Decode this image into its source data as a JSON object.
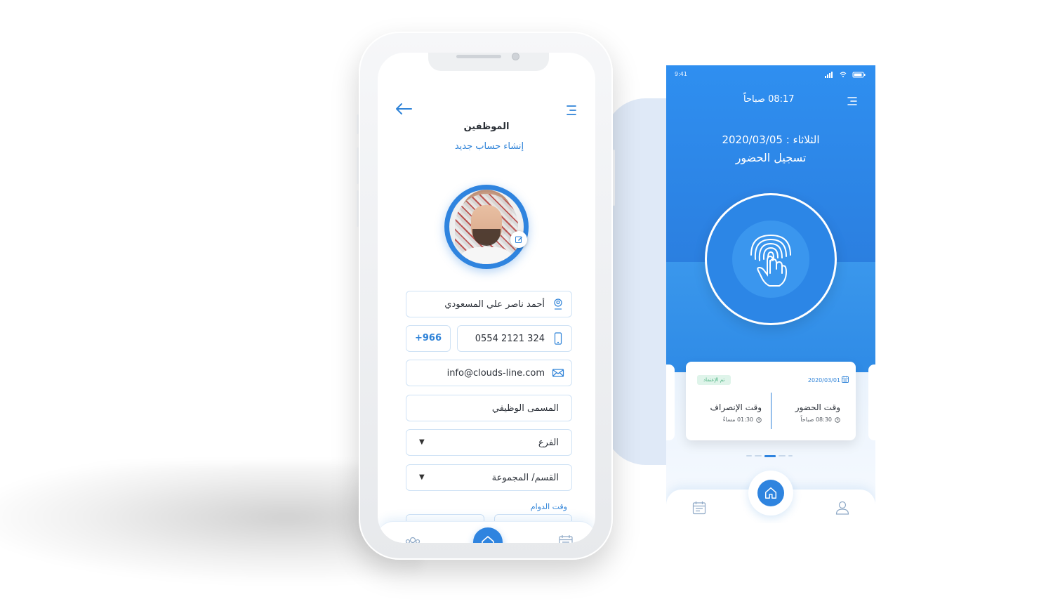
{
  "employee_screen": {
    "title": "الموظفين",
    "subtitle": "إنشاء حساب جديد",
    "fields": {
      "name": "أحمد ناصر علي المسعودي",
      "country_code": "+966",
      "phone": "0554 2121 324",
      "email": "info@clouds-line.com",
      "job_title_placeholder": "المسمى الوظيفي",
      "branch_placeholder": "الفرع",
      "department_placeholder": "القسم/ المجموعة"
    },
    "section_work_time": "وقت الدوام",
    "nav": [
      "users-icon",
      "home-icon",
      "calendar-icon"
    ]
  },
  "attendance_screen": {
    "status_time": "9:41",
    "clock": "08:17 صباحاً",
    "date_line": "الثلاثاء : 2020/03/05",
    "heading": "تسجيل الحضور",
    "card": {
      "badge": "تم الإعتماد",
      "date": "2020/03/01",
      "check_in_label": "وقت الحضور",
      "check_in_time": "08:30 صباحاً",
      "check_out_label": "وقت الإنصراف",
      "check_out_time": "01:30 مساءً"
    },
    "pagination": {
      "total": 5,
      "active": 2
    },
    "nav": [
      "calendar-icon",
      "home-icon",
      "profile-icon"
    ]
  },
  "colors": {
    "primary": "#2f84df",
    "accent_text": "#2f83d8",
    "badge_bg": "#dff4ea",
    "badge_text": "#48b07d"
  }
}
